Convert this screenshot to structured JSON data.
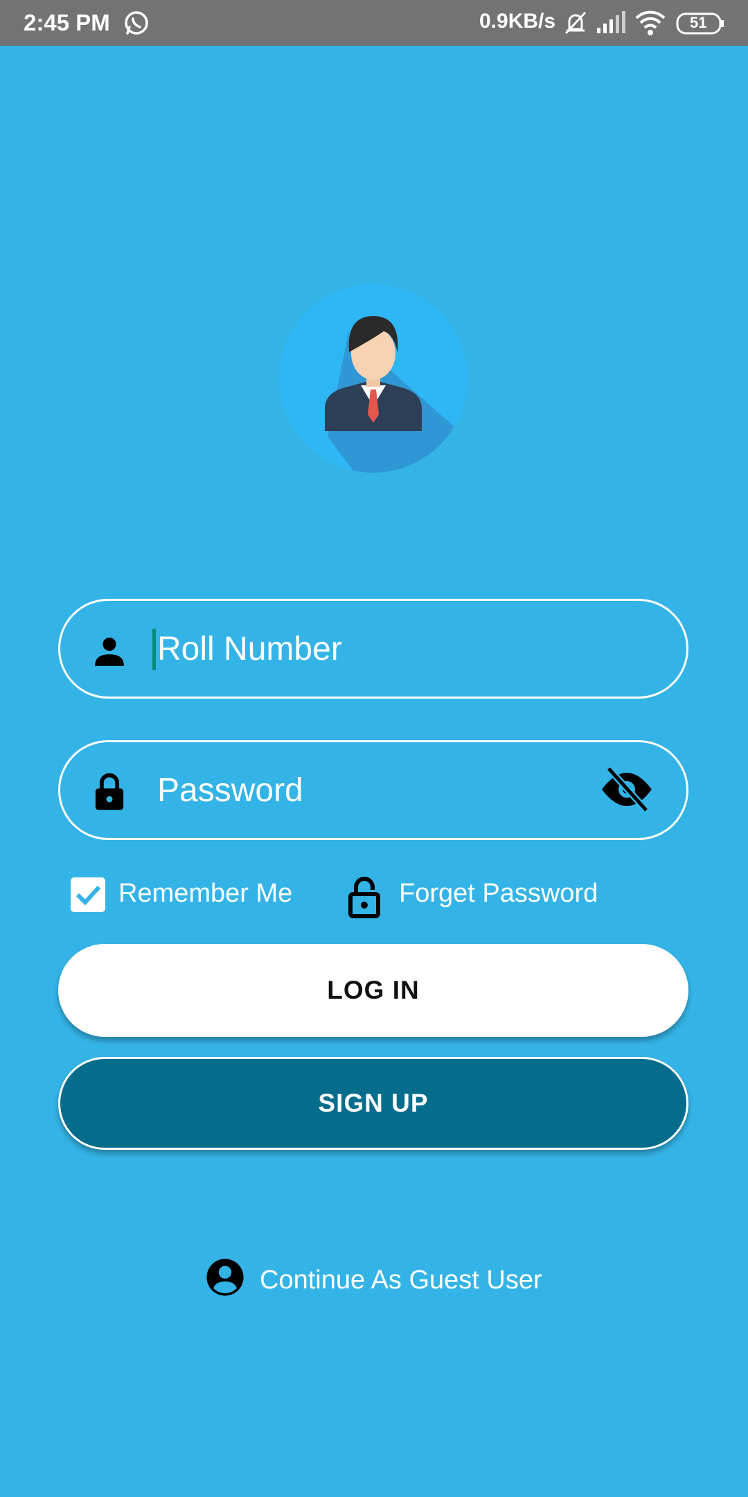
{
  "status_bar": {
    "time": "2:45 PM",
    "net_speed": "0.9KB/s",
    "battery": "51",
    "icons": [
      "whatsapp-icon",
      "bell-off-icon",
      "signal-icon",
      "wifi-icon",
      "battery-icon"
    ]
  },
  "colors": {
    "background": "#34b4e6",
    "status_bar": "#737373",
    "signup_button": "#066c8c",
    "login_button": "#ffffff"
  },
  "avatar": {
    "icon": "businessman-avatar-icon"
  },
  "form": {
    "roll_number": {
      "placeholder": "Roll Number",
      "value": "",
      "icon": "person-icon"
    },
    "password": {
      "placeholder": "Password",
      "value": "",
      "icon": "lock-icon",
      "toggle_icon": "eye-off-icon"
    },
    "remember_me": {
      "label": "Remember Me",
      "checked": true
    },
    "forget_password": {
      "label": "Forget Password",
      "icon": "lock-open-icon"
    }
  },
  "buttons": {
    "login": "LOG IN",
    "signup": "SIGN UP"
  },
  "guest": {
    "label": "Continue As Guest User",
    "icon": "account-circle-icon"
  }
}
